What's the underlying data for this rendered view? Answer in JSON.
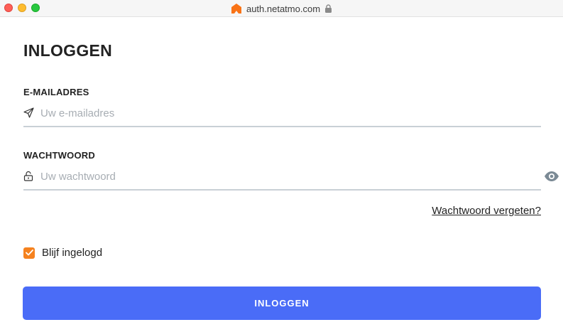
{
  "browser": {
    "url": "auth.netatmo.com",
    "site_icon": "netatmo-logo-icon",
    "secure_icon": "lock-icon"
  },
  "form": {
    "title": "INLOGGEN",
    "email": {
      "label": "E-MAILADRES",
      "placeholder": "Uw e-mailadres",
      "value": "",
      "icon": "send-icon"
    },
    "password": {
      "label": "WACHTWOORD",
      "placeholder": "Uw wachtwoord",
      "value": "",
      "icon": "unlock-icon",
      "toggle_icon": "eye-icon"
    },
    "forgot_link": "Wachtwoord vergeten?",
    "remember": {
      "label": "Blijf ingelogd",
      "checked": true
    },
    "submit_label": "INLOGGEN"
  },
  "colors": {
    "accent_button": "#4a6cf7",
    "checkbox": "#f5821f",
    "input_border": "#c9d0d6",
    "brand_logo": "#f97316"
  }
}
